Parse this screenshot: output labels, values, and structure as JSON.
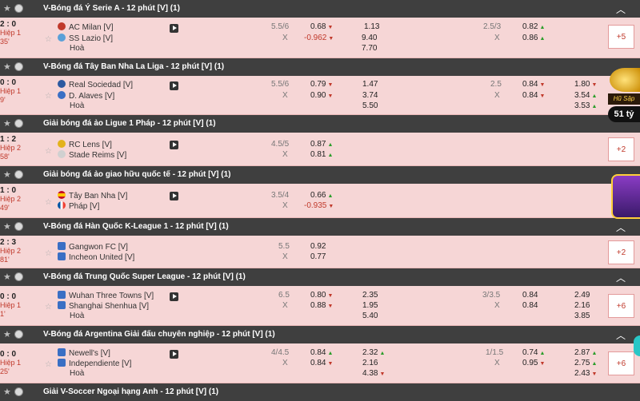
{
  "leagues": [
    {
      "title": "V-Bóng đá Ý Serie A - 12 phút [V] (1)"
    },
    {
      "title": "V-Bóng đá Tây Ban Nha La Liga - 12 phút [V] (1)"
    },
    {
      "title": "Giải bóng đá ảo Ligue 1 Pháp - 12 phút [V] (1)"
    },
    {
      "title": "Giải bóng đá ảo giao hữu quốc tế - 12 phút [V] (1)"
    },
    {
      "title": "V-Bóng đá Hàn Quốc K-League 1 - 12 phút [V] (1)"
    },
    {
      "title": "V-Bóng đá Trung Quốc Super League - 12 phút [V] (1)"
    },
    {
      "title": "V-Bóng đá Argentina Giải đấu chuyên nghiệp - 12 phút [V] (1)"
    },
    {
      "title": "Giải V-Soccer Ngoại hạng Anh - 12 phút [V] (1)"
    }
  ],
  "matches": [
    {
      "score": "2 : 0",
      "period": "Hiệp 1",
      "minute": "35'",
      "home": "AC Milan [V]",
      "away": "SS Lazio [V]",
      "draw": "Hoà",
      "hdp_line": "5.5/6",
      "hdp_x": "X",
      "hdp_home": "0.68",
      "hdp_away": "-0.962",
      "x12_1": "1.13",
      "x12_2": "9.40",
      "x12_x": "7.70",
      "ou_line": "2.5/3",
      "ou_x": "X",
      "ou_over": "0.82",
      "ou_under": "0.86",
      "more": "+5"
    },
    {
      "score": "0 : 0",
      "period": "Hiệp 1",
      "minute": "9'",
      "home": "Real Sociedad [V]",
      "away": "D. Alaves [V]",
      "draw": "Hoà",
      "hdp_line": "5.5/6",
      "hdp_x": "X",
      "hdp_home": "0.79",
      "hdp_away": "0.90",
      "x12_1": "1.47",
      "x12_2": "3.74",
      "x12_x": "5.50",
      "ou_line": "2.5",
      "ou_x": "X",
      "ou_over": "0.84",
      "ou_under": "0.84",
      "h1_1": "1.80",
      "h1_2": "3.54",
      "h1_x": "3.53",
      "more": ""
    },
    {
      "score": "1 : 2",
      "period": "Hiệp 2",
      "minute": "58'",
      "home": "RC Lens [V]",
      "away": "Stade Reims [V]",
      "hdp_line": "4.5/5",
      "hdp_x": "X",
      "hdp_home": "0.87",
      "hdp_away": "0.81",
      "more": "+2"
    },
    {
      "score": "1 : 0",
      "period": "Hiệp 2",
      "minute": "49'",
      "home": "Tây Ban Nha [V]",
      "away": "Pháp [V]",
      "hdp_line": "3.5/4",
      "hdp_x": "X",
      "hdp_home": "0.66",
      "hdp_away": "-0.935",
      "more": ""
    },
    {
      "score": "2 : 3",
      "period": "Hiệp 2",
      "minute": "81'",
      "home": "Gangwon FC [V]",
      "away": "Incheon United [V]",
      "hdp_line": "5.5",
      "hdp_x": "X",
      "hdp_home": "0.92",
      "hdp_away": "0.77",
      "more": "+2"
    },
    {
      "score": "0 : 0",
      "period": "Hiệp 1",
      "minute": "1'",
      "home": "Wuhan Three Towns [V]",
      "away": "Shanghai Shenhua [V]",
      "draw": "Hoà",
      "hdp_line": "6.5",
      "hdp_x": "X",
      "hdp_home": "0.80",
      "hdp_away": "0.88",
      "x12_1": "2.35",
      "x12_2": "1.95",
      "x12_x": "5.40",
      "ou_line": "3/3.5",
      "ou_x": "X",
      "ou_over": "0.84",
      "ou_under": "0.84",
      "h1_1": "2.49",
      "h1_2": "2.16",
      "h1_x": "3.85",
      "more": "+6"
    },
    {
      "score": "0 : 0",
      "period": "Hiệp 1",
      "minute": "25'",
      "home": "Newell's [V]",
      "away": "Independiente [V]",
      "draw": "Hoà",
      "hdp_line": "4/4.5",
      "hdp_x": "X",
      "hdp_home": "0.84",
      "hdp_away": "0.84",
      "x12_1": "2.32",
      "x12_2": "2.16",
      "x12_x": "4.38",
      "ou_line": "1/1.5",
      "ou_x": "X",
      "ou_over": "0.74",
      "ou_under": "0.95",
      "h1_1": "2.87",
      "h1_2": "2.75",
      "h1_x": "2.43",
      "more": "+6"
    }
  ],
  "banner": {
    "line1": "Hũ Sập",
    "line2": "51 tỷ"
  },
  "icons": {
    "star": "star-icon",
    "ball": "ball-icon",
    "tv": "live-tv-icon",
    "caret": "collapse-caret-icon"
  },
  "colors": {
    "header_bg": "#3f3f3f",
    "row_bg": "#f6d6d6",
    "accent_red": "#c0392b",
    "up_green": "#2a9d2a"
  }
}
